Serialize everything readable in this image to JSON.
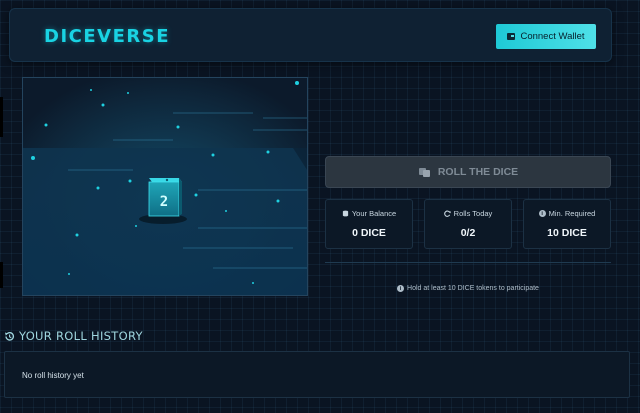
{
  "header": {
    "logo": "DICEVERSE",
    "connect_wallet_label": "Connect Wallet",
    "wallet_icon": "wallet-icon"
  },
  "scene": {
    "die_face_value": "2",
    "accent_color": "#19d3e3"
  },
  "roll_button": {
    "label": "ROLL THE DICE",
    "icon": "dice-icon",
    "state": "disabled"
  },
  "stats": [
    {
      "icon": "coins-icon",
      "label": "Your Balance",
      "value": "0 DICE"
    },
    {
      "icon": "refresh-icon",
      "label": "Rolls Today",
      "value": "0/2"
    },
    {
      "icon": "info-icon",
      "label": "Min. Required",
      "value": "10 DICE"
    }
  ],
  "notice": {
    "icon": "info-icon",
    "text": "Hold at least 10 DICE tokens to participate"
  },
  "history": {
    "title": "YOUR ROLL HISTORY",
    "icon": "history-icon",
    "empty_text": "No roll history yet"
  },
  "colors": {
    "background": "#0a1422",
    "accent": "#19d3e3",
    "button_disabled": "#2c3640"
  }
}
